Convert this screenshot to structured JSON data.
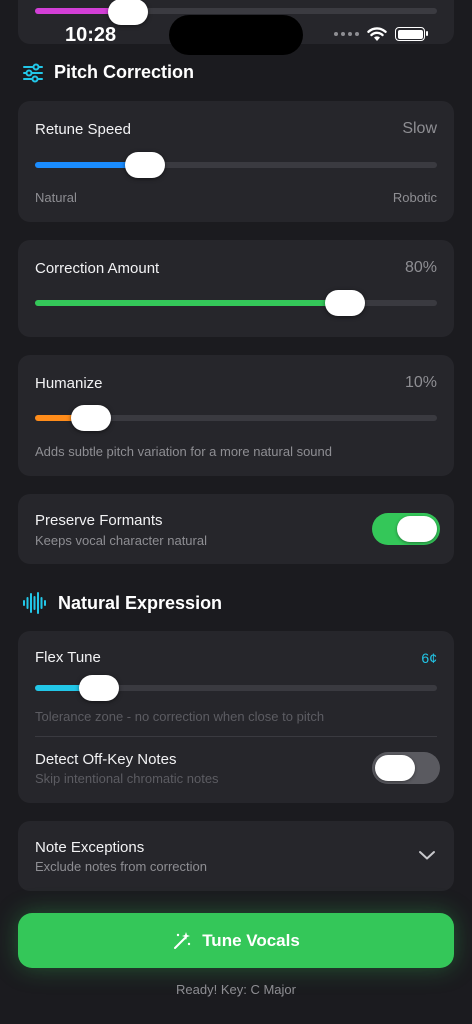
{
  "status_bar": {
    "time": "10:28"
  },
  "top_slider": {
    "level": 0.23,
    "color": "#d33fd7"
  },
  "pitch_correction": {
    "title": "Pitch Correction",
    "icon": "sliders-icon",
    "retune_speed": {
      "label": "Retune Speed",
      "value": "Slow",
      "level": 0.27,
      "min_label": "Natural",
      "max_label": "Robotic",
      "color": "#1a8cff"
    },
    "correction_amount": {
      "label": "Correction Amount",
      "value": "80%",
      "level": 0.77,
      "color": "#34c759"
    },
    "humanize": {
      "label": "Humanize",
      "value": "10%",
      "level": 0.14,
      "hint": "Adds subtle pitch variation for a more natural sound",
      "color": "#ff8c1a"
    },
    "preserve_formants": {
      "label": "Preserve Formants",
      "sublabel": "Keeps vocal character natural",
      "on": true
    }
  },
  "natural_expression": {
    "title": "Natural Expression",
    "icon": "waveform-icon",
    "flex_tune": {
      "label": "Flex Tune",
      "value": "6¢",
      "level": 0.16,
      "hint": "Tolerance zone - no correction when close to pitch",
      "color": "#22c7e8"
    },
    "detect_off_key": {
      "label": "Detect Off-Key Notes",
      "sublabel": "Skip intentional chromatic notes",
      "on": false
    }
  },
  "note_exceptions": {
    "label": "Note Exceptions",
    "sublabel": "Exclude notes from correction",
    "icon": "chevron-down-icon"
  },
  "cta": {
    "label": "Tune Vocals",
    "icon": "magic-wand-icon"
  },
  "footer": {
    "status": "Ready! Key: C Major"
  }
}
